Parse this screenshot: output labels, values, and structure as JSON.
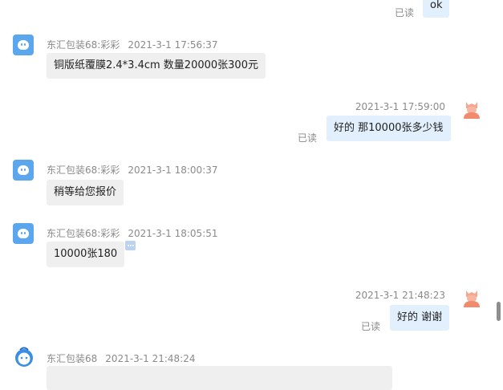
{
  "messages": {
    "m0": {
      "text": "ok",
      "read": "已读"
    },
    "m1": {
      "sender": "东汇包装68:彩彩",
      "time": "2021-3-1 17:56:37",
      "text": "铜版纸覆膜2.4*3.4cm 数量20000张300元"
    },
    "m2": {
      "time": "2021-3-1 17:59:00",
      "text": "好的 那10000张多少钱",
      "read": "已读"
    },
    "m3": {
      "sender": "东汇包装68:彩彩",
      "time": "2021-3-1 18:00:37",
      "text": "稍等给您报价"
    },
    "m4": {
      "sender": "东汇包装68:彩彩",
      "time": "2021-3-1 18:05:51",
      "text": "10000张180"
    },
    "m5": {
      "time": "2021-3-1 21:48:23",
      "text": "好的 谢谢",
      "read": "已读"
    },
    "m6": {
      "sender": "东汇包装68",
      "time": "2021-3-1 21:48:24"
    }
  },
  "icons": {
    "shop_avatar": "shop-avatar-icon",
    "user_avatar": "user-avatar-icon",
    "bot_avatar": "droplet-avatar-icon",
    "more": "more-options-icon"
  },
  "colors": {
    "incoming_bubble": "#efefef",
    "outgoing_bubble": "#e2effd",
    "shop_avatar": "#5ba6ec",
    "user_avatar": "#f28b6e"
  }
}
